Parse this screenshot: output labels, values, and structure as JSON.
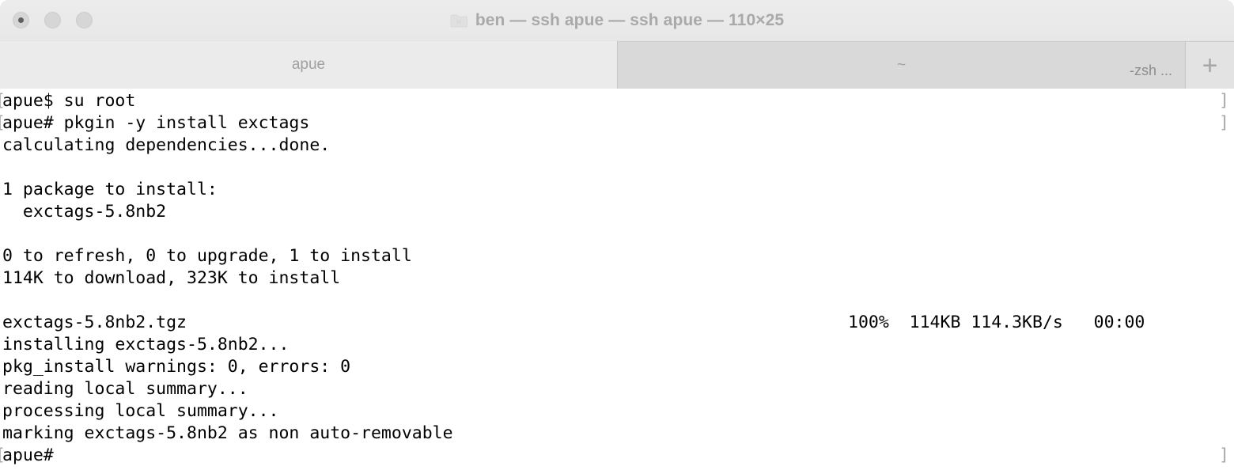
{
  "window": {
    "title": "ben — ssh apue — ssh apue — 110×25",
    "folder_icon": "folder-icon",
    "traffic_lights": [
      {
        "name": "close",
        "has_dot": true
      },
      {
        "name": "minimize",
        "has_dot": false
      },
      {
        "name": "zoom",
        "has_dot": false
      }
    ]
  },
  "tabs": {
    "items": [
      {
        "label": "apue",
        "sub": "",
        "active": true
      },
      {
        "label": "~",
        "sub": "-zsh ...",
        "active": false
      }
    ],
    "new_tab_label": "+"
  },
  "terminal": {
    "lines": [
      {
        "prompt": true,
        "text": "apue$ su root"
      },
      {
        "prompt": true,
        "text": "apue# pkgin -y install exctags"
      },
      {
        "prompt": false,
        "text": "calculating dependencies...done."
      },
      {
        "prompt": false,
        "text": ""
      },
      {
        "prompt": false,
        "text": "1 package to install:"
      },
      {
        "prompt": false,
        "text": "  exctags-5.8nb2"
      },
      {
        "prompt": false,
        "text": ""
      },
      {
        "prompt": false,
        "text": "0 to refresh, 0 to upgrade, 1 to install"
      },
      {
        "prompt": false,
        "text": "114K to download, 323K to install"
      },
      {
        "prompt": false,
        "text": ""
      },
      {
        "prompt": false,
        "text": "exctags-5.8nb2.tgz",
        "right": "100%  114KB 114.3KB/s   00:00"
      },
      {
        "prompt": false,
        "text": "installing exctags-5.8nb2..."
      },
      {
        "prompt": false,
        "text": "pkg_install warnings: 0, errors: 0"
      },
      {
        "prompt": false,
        "text": "reading local summary..."
      },
      {
        "prompt": false,
        "text": "processing local summary..."
      },
      {
        "prompt": false,
        "text": "marking exctags-5.8nb2 as non auto-removable"
      },
      {
        "prompt": true,
        "text": "apue#"
      }
    ],
    "bracket_open": "[",
    "bracket_close": "]"
  },
  "colors": {
    "titlebar": "#ececec",
    "tabbar": "#ebebeb",
    "inactive_tab": "#d9d9d9",
    "terminal_bg": "#ffffff",
    "terminal_fg": "#000000",
    "bracket": "#a8a8a8",
    "title_text": "#a9a9a9"
  }
}
